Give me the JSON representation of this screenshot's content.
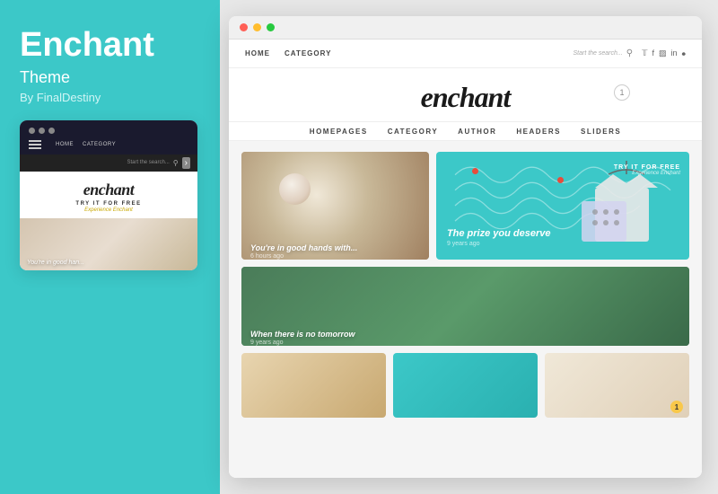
{
  "sidebar": {
    "title": "Enchant",
    "subtitle": "Theme",
    "author": "By FinalDestiny"
  },
  "mini_preview": {
    "nav_links": [
      "HOME",
      "CATEGORY"
    ],
    "search_placeholder": "Start the search...",
    "logo_text": "enchant",
    "try_label": "TRY IT FOR FREE",
    "experience_label": "Experience Enchant",
    "thumb_caption": "You're in good han..."
  },
  "browser": {
    "top_nav": {
      "links": [
        "HOME",
        "CATEGORY"
      ],
      "search_placeholder": "Start the search...",
      "social_icons": [
        "twitter",
        "facebook",
        "instagram",
        "linkedin",
        "pinterest"
      ]
    },
    "logo": "enchant",
    "notification_count": "1",
    "main_nav": {
      "links": [
        "HOMEPAGES",
        "CATEGORY",
        "AUTHOR",
        "HEADERS",
        "SLIDERS"
      ]
    },
    "cards": [
      {
        "id": "card-top-left",
        "caption": "You're in good hands with...",
        "sub_caption": "6 hours ago"
      },
      {
        "id": "card-top-right",
        "try_label": "TRY IT FOR FREE",
        "try_sub": "Experience Enchant",
        "title": "The prize you deserve",
        "sub": "9 years ago"
      },
      {
        "id": "card-mid-left",
        "caption": "When there is no tomorrow",
        "sub_caption": "9 years ago"
      }
    ],
    "bottom_cards": [
      {
        "id": "bot-1",
        "badge": ""
      },
      {
        "id": "bot-2",
        "badge": ""
      },
      {
        "id": "bot-3",
        "badge": "1"
      }
    ]
  },
  "colors": {
    "teal": "#3cc8c8",
    "dark_nav": "#1a1a2e",
    "accent_yellow": "#f9c84a"
  }
}
